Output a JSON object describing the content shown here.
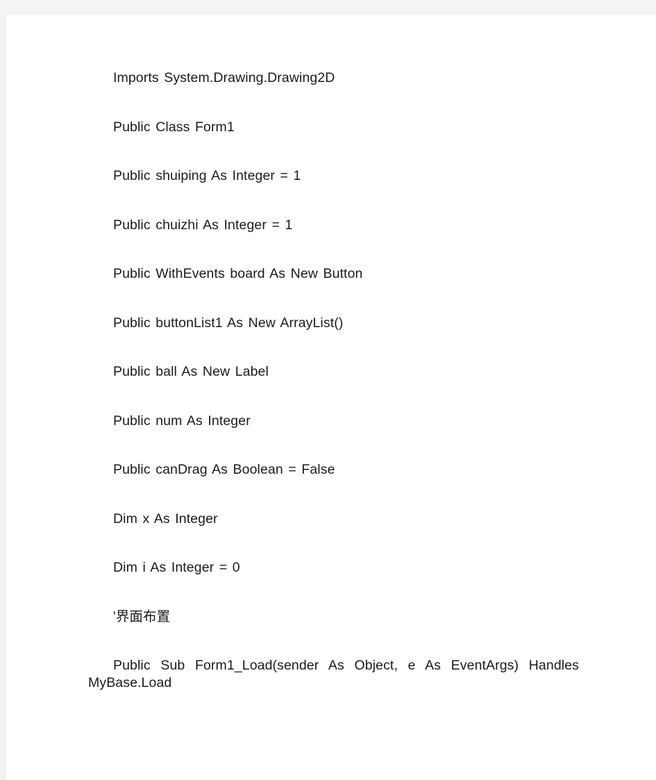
{
  "page": {
    "background_color": "#f4f4f4",
    "sheet_color": "#ffffff",
    "text_color": "#1a1a1a"
  },
  "document": {
    "lines": [
      {
        "text": "Imports System.Drawing.Drawing2D",
        "justified": false
      },
      {
        "text": "Public Class Form1",
        "justified": false
      },
      {
        "text": "Public shuiping As Integer = 1",
        "justified": false
      },
      {
        "text": "Public chuizhi As Integer = 1",
        "justified": false
      },
      {
        "text": "Public WithEvents board As New Button",
        "justified": false
      },
      {
        "text": "Public buttonList1 As New ArrayList()",
        "justified": false
      },
      {
        "text": "Public ball As New Label",
        "justified": false
      },
      {
        "text": "Public num As Integer",
        "justified": false
      },
      {
        "text": "Public canDrag As Boolean = False",
        "justified": false
      },
      {
        "text": "Dim x As Integer",
        "justified": false
      },
      {
        "text": "Dim i As Integer = 0",
        "justified": false
      },
      {
        "text": "'界面布置",
        "justified": false
      },
      {
        "text": "Public Sub Form1_Load(sender As Object, e As EventArgs) Handles MyBase.Load",
        "justified": true
      }
    ]
  }
}
